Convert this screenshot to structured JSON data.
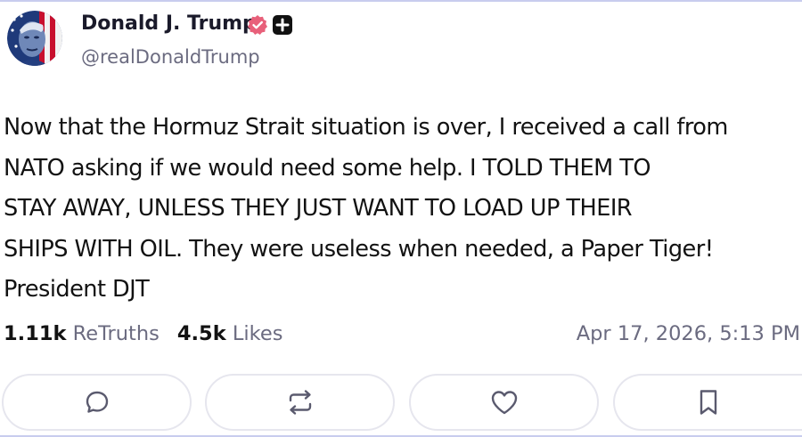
{
  "author": {
    "display_name": "Donald J. Trump",
    "handle": "@realDonaldTrump",
    "verified_icon": "verified-badge-icon",
    "extra_icon": "plus-icon",
    "verified_color": "#e8607a"
  },
  "post": {
    "text": "Now that the Hormuz Strait situation is over, I received a call from\nNATO asking if we would need some help. I  TOLD THEM TO\nSTAY AWAY, UNLESS THEY JUST WANT TO LOAD UP THEIR\nSHIPS WITH OIL. They were useless when needed, a Paper Tiger!\nPresident DJT"
  },
  "stats": {
    "retruths_count": "1.11k",
    "retruths_label": "ReTruths",
    "likes_count": "4.5k",
    "likes_label": "Likes",
    "timestamp": "Apr 17, 2026, 5:13 PM"
  },
  "actions": [
    {
      "name": "reply",
      "icon": "comment-icon"
    },
    {
      "name": "retruth",
      "icon": "repost-icon"
    },
    {
      "name": "like",
      "icon": "heart-icon"
    },
    {
      "name": "bookmark",
      "icon": "bookmark-icon"
    }
  ]
}
